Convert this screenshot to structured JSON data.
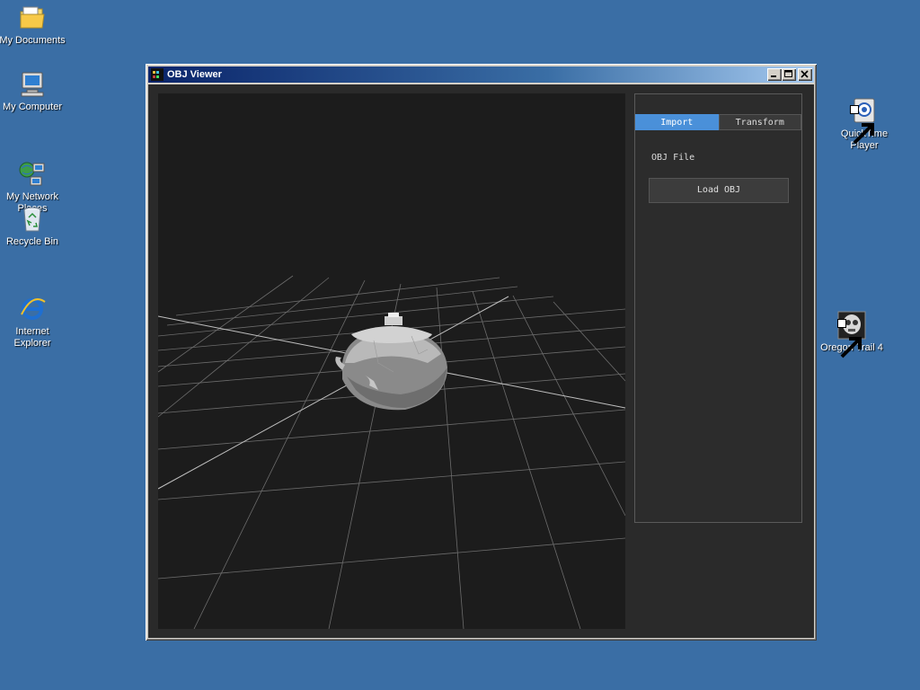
{
  "desktop": {
    "icons_left": [
      {
        "label": "My Documents",
        "icon": "folder-icon"
      },
      {
        "label": "My Computer",
        "icon": "computer-icon"
      },
      {
        "label": "My Network\nPlaces",
        "icon": "network-icon"
      },
      {
        "label": "Recycle Bin",
        "icon": "recycle-bin-icon"
      },
      {
        "label": "Internet\nExplorer",
        "icon": "internet-explorer-icon"
      }
    ],
    "icons_right": [
      {
        "label": "QuickTime\nPlayer",
        "icon": "quicktime-icon"
      },
      {
        "label": "Oregon Trail 4",
        "icon": "oregon-trail-icon"
      }
    ],
    "background_color": "#3a6ea5"
  },
  "window": {
    "title": "OBJ Viewer",
    "buttons": [
      "minimize",
      "maximize",
      "close"
    ]
  },
  "panel": {
    "tabs": [
      {
        "label": "Import",
        "active": true
      },
      {
        "label": "Transform",
        "active": false
      }
    ],
    "obj_file_label": "OBJ File",
    "load_button_label": "Load OBJ",
    "accent_color": "#4a90d9"
  },
  "viewport": {
    "background_color": "#1c1c1c",
    "model": "teapot"
  }
}
